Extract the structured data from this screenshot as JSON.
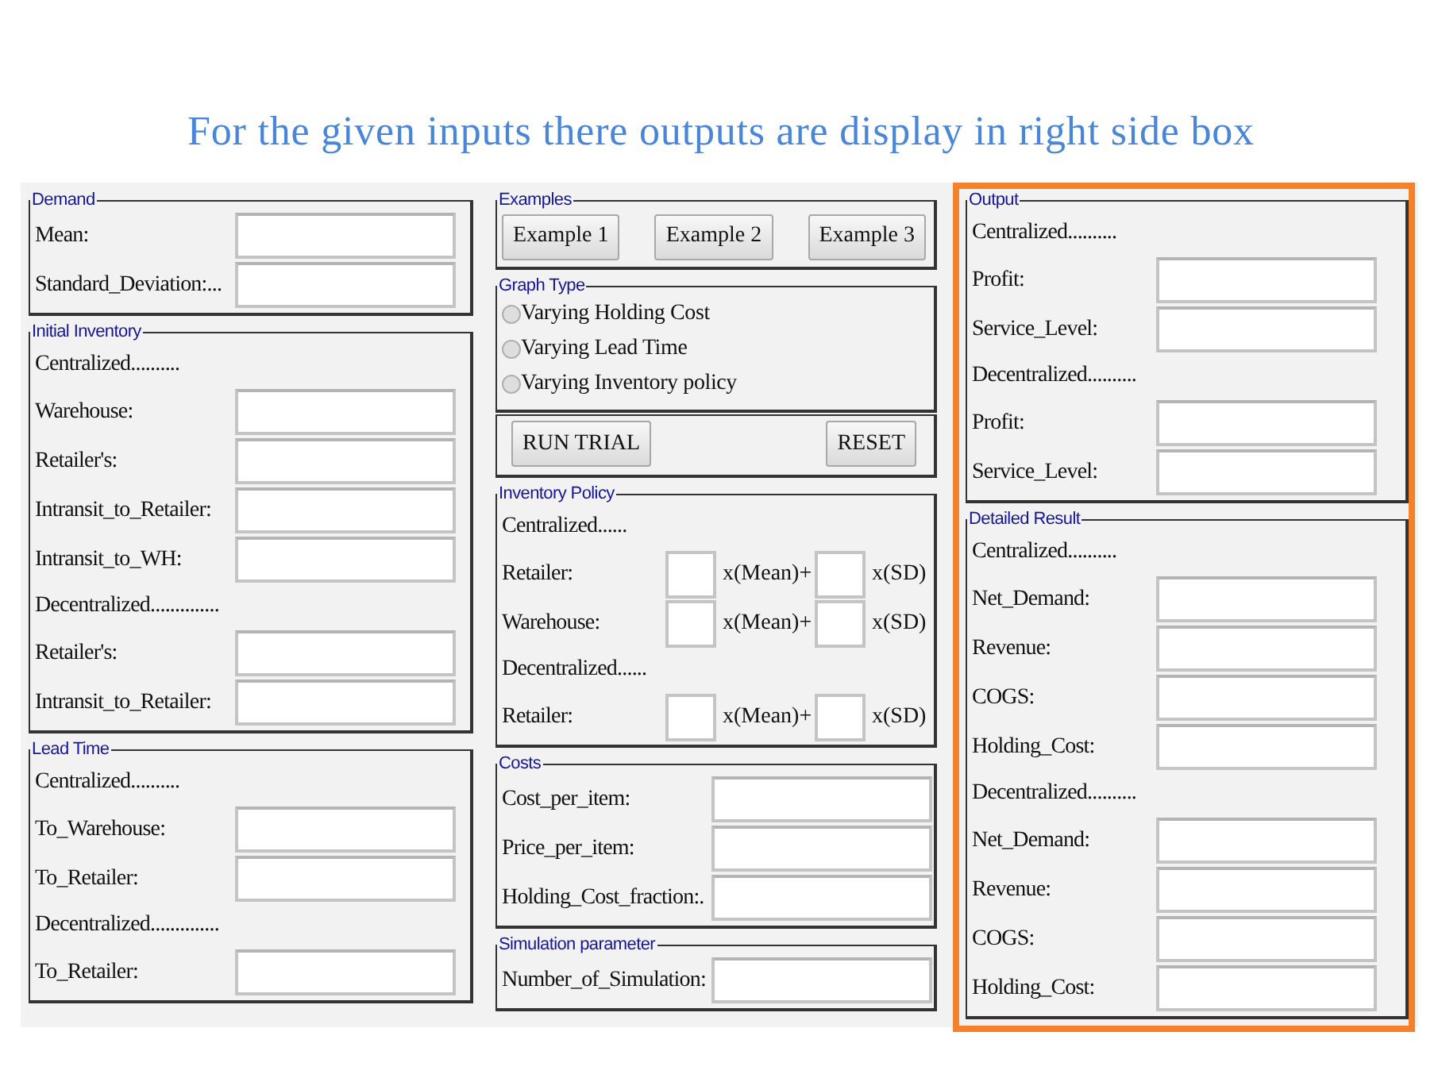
{
  "title": "For the given inputs there outputs are display in right side box",
  "columns": [
    {
      "highlighted": false,
      "sections": [
        {
          "legend": "Demand",
          "rows": [
            {
              "kind": "field",
              "label": "Mean:"
            },
            {
              "kind": "field",
              "label": "Standard_Deviation:..."
            }
          ]
        },
        {
          "legend": "Initial Inventory",
          "rows": [
            {
              "kind": "heading",
              "text": "Centralized.........."
            },
            {
              "kind": "field",
              "label": "Warehouse:"
            },
            {
              "kind": "field",
              "label": "Retailer's:"
            },
            {
              "kind": "field",
              "label": "Intransit_to_Retailer:"
            },
            {
              "kind": "field",
              "label": "Intransit_to_WH:"
            },
            {
              "kind": "heading",
              "text": "Decentralized.............."
            },
            {
              "kind": "field",
              "label": "Retailer's:"
            },
            {
              "kind": "field",
              "label": "Intransit_to_Retailer:"
            }
          ]
        },
        {
          "legend": "Lead Time",
          "rows": [
            {
              "kind": "heading",
              "text": "Centralized.........."
            },
            {
              "kind": "field",
              "label": "To_Warehouse:"
            },
            {
              "kind": "field",
              "label": "To_Retailer:"
            },
            {
              "kind": "heading",
              "text": "Decentralized.............."
            },
            {
              "kind": "field",
              "label": "To_Retailer:"
            }
          ]
        }
      ]
    },
    {
      "highlighted": false,
      "sections": [
        {
          "legend": "Examples",
          "rows": [
            {
              "kind": "buttons",
              "buttons": [
                "Example 1",
                "Example 2",
                "Example 3"
              ]
            }
          ]
        },
        {
          "legend": "Graph Type",
          "rows": [
            {
              "kind": "radio",
              "label": "Varying Holding Cost",
              "selected": false
            },
            {
              "kind": "radio",
              "label": "Varying Lead Time",
              "selected": false
            },
            {
              "kind": "radio",
              "label": "Varying Inventory policy",
              "selected": false
            }
          ]
        },
        {
          "rows": [
            {
              "kind": "buttons",
              "buttons": [
                "RUN TRIAL",
                "RESET"
              ]
            }
          ]
        },
        {
          "legend": "Inventory Policy",
          "rows": [
            {
              "kind": "heading",
              "text": "Centralized......"
            },
            {
              "kind": "policy",
              "label": "Retailer:",
              "mean_unit": "x(Mean)+",
              "sd_unit": "x(SD)"
            },
            {
              "kind": "policy",
              "label": "Warehouse:",
              "mean_unit": "x(Mean)+",
              "sd_unit": "x(SD)"
            },
            {
              "kind": "heading",
              "text": "Decentralized......"
            },
            {
              "kind": "policy",
              "label": "Retailer:",
              "mean_unit": "x(Mean)+",
              "sd_unit": "x(SD)"
            }
          ]
        },
        {
          "legend": "Costs",
          "rows": [
            {
              "kind": "field",
              "label": "Cost_per_item:"
            },
            {
              "kind": "field",
              "label": "Price_per_item:"
            },
            {
              "kind": "field",
              "label": "Holding_Cost_fraction:."
            }
          ]
        },
        {
          "legend": "Simulation parameter",
          "rows": [
            {
              "kind": "field",
              "label": "Number_of_Simulation:"
            }
          ]
        }
      ]
    },
    {
      "highlighted": true,
      "sections": [
        {
          "legend": "Output",
          "rows": [
            {
              "kind": "heading",
              "text": "Centralized.........."
            },
            {
              "kind": "field",
              "label": "Profit:"
            },
            {
              "kind": "field",
              "label": "Service_Level:"
            },
            {
              "kind": "heading",
              "text": "Decentralized.........."
            },
            {
              "kind": "field",
              "label": "Profit:"
            },
            {
              "kind": "field",
              "label": "Service_Level:"
            }
          ]
        },
        {
          "legend": "Detailed Result",
          "rows": [
            {
              "kind": "heading",
              "text": "Centralized.........."
            },
            {
              "kind": "field",
              "label": "Net_Demand:"
            },
            {
              "kind": "field",
              "label": "Revenue:"
            },
            {
              "kind": "field",
              "label": "COGS:"
            },
            {
              "kind": "field",
              "label": "Holding_Cost:"
            },
            {
              "kind": "heading",
              "text": "Decentralized.........."
            },
            {
              "kind": "field",
              "label": "Net_Demand:"
            },
            {
              "kind": "field",
              "label": "Revenue:"
            },
            {
              "kind": "field",
              "label": "COGS:"
            },
            {
              "kind": "field",
              "label": "Holding_Cost:"
            }
          ]
        }
      ]
    }
  ]
}
